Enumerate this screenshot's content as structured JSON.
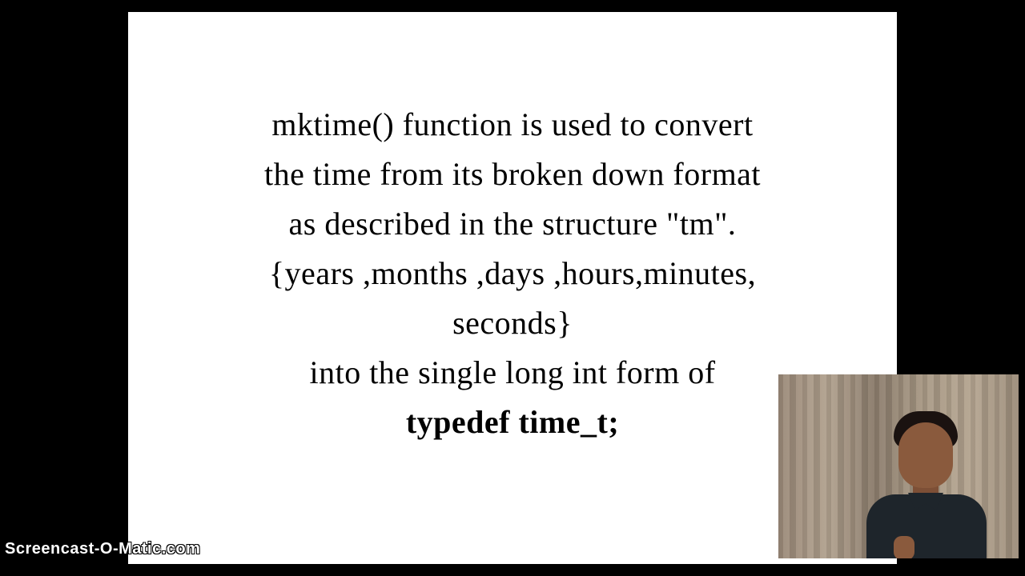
{
  "slide": {
    "line1": "mktime() function is used to convert",
    "line2": "the time from its broken down format",
    "line3": "as described in the structure \"tm\".",
    "line4": "{years ,months ,days ,hours,minutes,",
    "line5": "seconds}",
    "line6": "into the single long int form of",
    "line7": "typedef time_t;"
  },
  "watermark": "Screencast-O-Matic.com"
}
